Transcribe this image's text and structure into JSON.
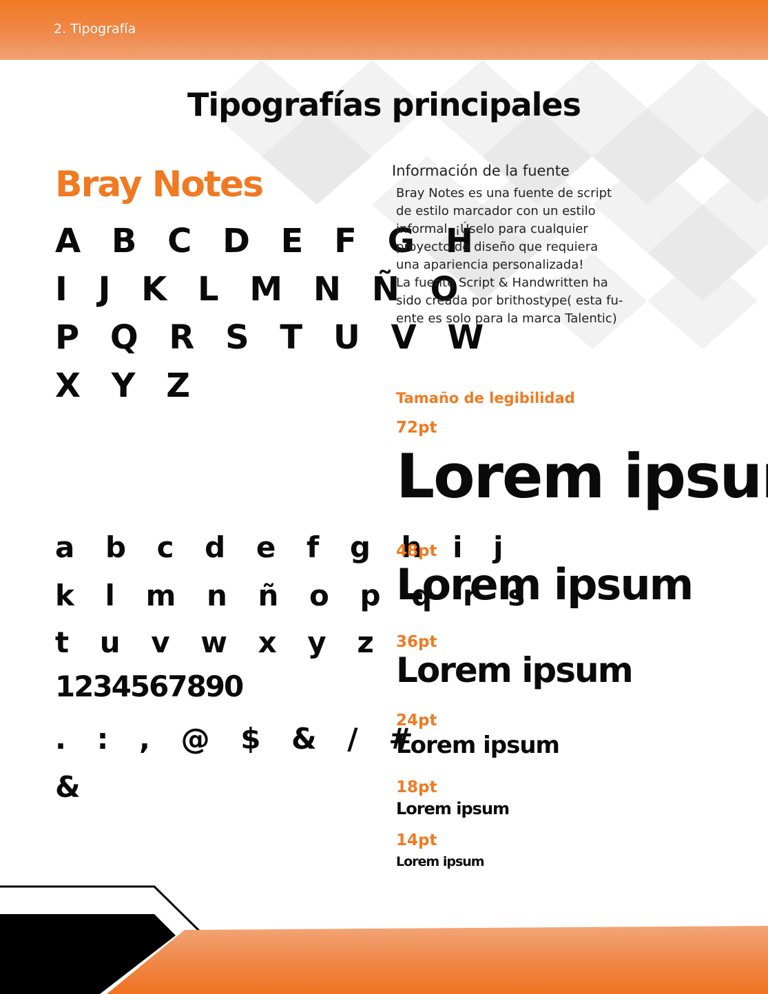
{
  "header": {
    "section": "2. Tipografía"
  },
  "title": "Tipografías principales",
  "font": {
    "name": "Bray Notes",
    "uppercase": [
      "A B C D E F G H",
      "I J K L M N Ñ O",
      "P Q R S T U V W",
      "X Y Z"
    ],
    "lowercase": [
      "a b c d e f g h i j",
      "k l m n ñ o p q r s",
      "t u v w x y z",
      "1234567890",
      ". : , @ $ & / #",
      "&"
    ]
  },
  "info": {
    "title": "Información de la fuente",
    "lines": [
      "Bray Notes es una fuente de script",
      "de estilo marcador con un estilo",
      "informal. ¡Úselo para cualquier",
      "proyecto de diseño que requiera",
      "una apariencia personalizada!",
      "La fuente Script & Handwritten ha",
      "sido creada por brithostype( esta fu-",
      "ente es solo para la marca Talentic)"
    ]
  },
  "legibility": {
    "title": "Tamaño de legibilidad",
    "sizes": [
      {
        "label": "72pt",
        "sample": "Lorem ipsum"
      },
      {
        "label": "48pt",
        "sample": "Lorem ipsum"
      },
      {
        "label": "36pt",
        "sample": "Lorem ipsum"
      },
      {
        "label": "24pt",
        "sample": "Lorem ipsum"
      },
      {
        "label": "18pt",
        "sample": "Lorem ipsum"
      },
      {
        "label": "14pt",
        "sample": "Lorem ipsum"
      }
    ]
  },
  "colors": {
    "accent": "#f07a22",
    "text": "#0a0a0a",
    "footer_dark": "#000000"
  }
}
